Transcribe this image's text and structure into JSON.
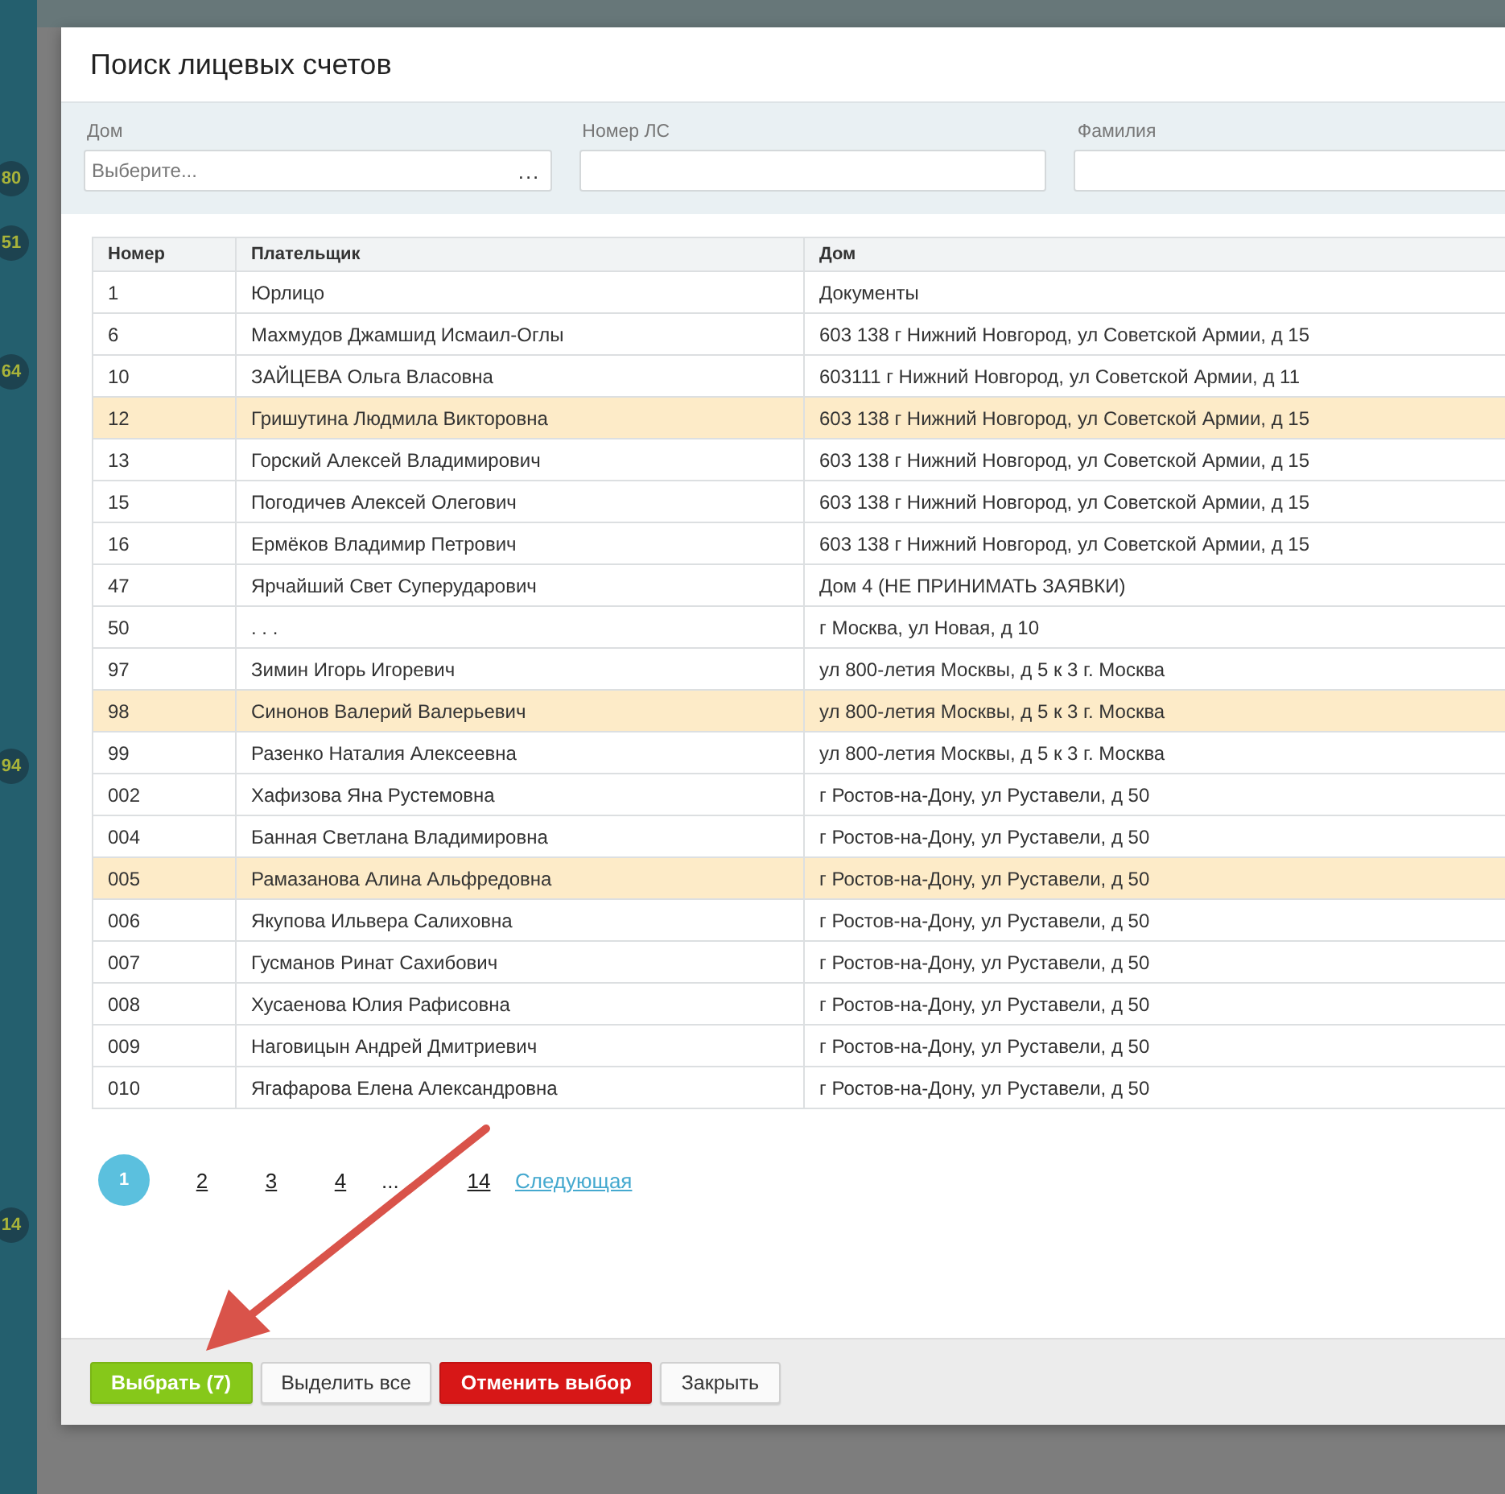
{
  "background_badges": [
    "80",
    "51",
    "64",
    "94",
    "14"
  ],
  "dialog": {
    "title": "Поиск лицевых счетов"
  },
  "filters": [
    {
      "label": "Дом",
      "placeholder": "Выберите...",
      "picker": "..."
    },
    {
      "label": "Номер ЛС"
    },
    {
      "label": "Фамилия"
    }
  ],
  "table": {
    "columns": [
      "Номер",
      "Плательщик",
      "Дом"
    ],
    "rows": [
      {
        "cells": [
          "1",
          "Юрлицо",
          "Документы"
        ],
        "selected": false
      },
      {
        "cells": [
          "6",
          "Махмудов Джамшид Исмаил-Оглы",
          "603 138 г Нижний Новгород, ул Советской Армии, д 15"
        ],
        "selected": false
      },
      {
        "cells": [
          "10",
          "ЗАЙЦЕВА Ольга Власовна",
          "603111 г Нижний Новгород, ул Советской Армии, д 11"
        ],
        "selected": false
      },
      {
        "cells": [
          "12",
          "Гришутина Людмила Викторовна",
          "603 138 г Нижний Новгород, ул Советской Армии, д 15"
        ],
        "selected": true
      },
      {
        "cells": [
          "13",
          "Горский Алексей Владимирович",
          "603 138 г Нижний Новгород, ул Советской Армии, д 15"
        ],
        "selected": false
      },
      {
        "cells": [
          "15",
          "Погодичев Алексей Олегович",
          "603 138 г Нижний Новгород, ул Советской Армии, д 15"
        ],
        "selected": false
      },
      {
        "cells": [
          "16",
          "Ермёков Владимир Петрович",
          "603 138 г Нижний Новгород, ул Советской Армии, д 15"
        ],
        "selected": false
      },
      {
        "cells": [
          "47",
          "Ярчайший Свет Суперударович",
          "Дом 4 (НЕ ПРИНИМАТЬ ЗАЯВКИ)"
        ],
        "selected": false
      },
      {
        "cells": [
          "50",
          ". . .",
          "г Москва, ул Новая, д 10"
        ],
        "selected": false
      },
      {
        "cells": [
          "97",
          "Зимин Игорь Игоревич",
          "ул 800-летия Москвы, д 5 к 3 г. Москва"
        ],
        "selected": false
      },
      {
        "cells": [
          "98",
          "Синонов Валерий Валерьевич",
          "ул 800-летия Москвы, д 5 к 3 г. Москва"
        ],
        "selected": true
      },
      {
        "cells": [
          "99",
          "Разенко Наталия Алексеевна",
          "ул 800-летия Москвы, д 5 к 3 г. Москва"
        ],
        "selected": false
      },
      {
        "cells": [
          "002",
          "Хафизова Яна Рустемовна",
          "г Ростов-на-Дону, ул Руставели, д 50"
        ],
        "selected": false
      },
      {
        "cells": [
          "004",
          "Банная Светлана Владимировна",
          "г Ростов-на-Дону, ул Руставели, д 50"
        ],
        "selected": false
      },
      {
        "cells": [
          "005",
          "Рамазанова Алина Альфредовна",
          "г Ростов-на-Дону, ул Руставели, д 50"
        ],
        "selected": true
      },
      {
        "cells": [
          "006",
          "Якупова Ильвера Салиховна",
          "г Ростов-на-Дону, ул Руставели, д 50"
        ],
        "selected": false
      },
      {
        "cells": [
          "007",
          "Гусманов Ринат Сахибович",
          "г Ростов-на-Дону, ул Руставели, д 50"
        ],
        "selected": false
      },
      {
        "cells": [
          "008",
          "Хусаенова Юлия Рафисовна",
          "г Ростов-на-Дону, ул Руставели, д 50"
        ],
        "selected": false
      },
      {
        "cells": [
          "009",
          "Наговицын Андрей Дмитриевич",
          "г Ростов-на-Дону, ул Руставели, д 50"
        ],
        "selected": false
      },
      {
        "cells": [
          "010",
          "Ягафарова Елена Александровна",
          "г Ростов-на-Дону, ул Руставели, д 50"
        ],
        "selected": false
      }
    ]
  },
  "pagination": {
    "pages": [
      {
        "label": "1",
        "kind": "page",
        "selected": true
      },
      {
        "label": "2",
        "kind": "page",
        "selected": false
      },
      {
        "label": "3",
        "kind": "page",
        "selected": false
      },
      {
        "label": "4",
        "kind": "page",
        "selected": false
      },
      {
        "label": "...",
        "kind": "gap"
      },
      {
        "label": "14",
        "kind": "page",
        "selected": false
      }
    ],
    "next": "Следующая"
  },
  "buttons": [
    {
      "label": "Выбрать (7)",
      "kind": "primary"
    },
    {
      "label": "Выделить все",
      "kind": "default"
    },
    {
      "label": "Отменить выбор",
      "kind": "danger"
    },
    {
      "label": "Закрыть",
      "kind": "default"
    }
  ]
}
